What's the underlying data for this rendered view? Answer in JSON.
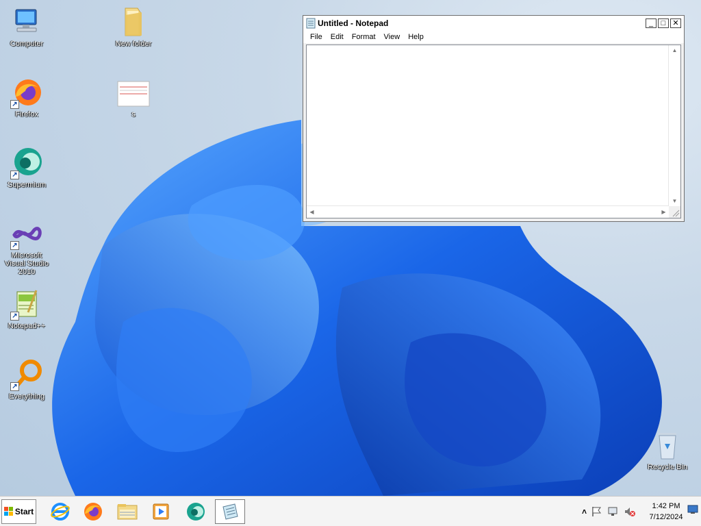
{
  "desktop": {
    "icons": [
      {
        "label": "Computer",
        "icon": "computer-icon"
      },
      {
        "label": "New folder",
        "icon": "folder-icon"
      },
      {
        "label": "Firefox",
        "icon": "firefox-icon"
      },
      {
        "label": "s",
        "icon": "document-icon"
      },
      {
        "label": "Supermium",
        "icon": "supermium-icon"
      },
      {
        "label": "Microsoft Visual Studio 2010",
        "icon": "visual-studio-icon"
      },
      {
        "label": "Notepad++",
        "icon": "notepad-plus-plus-icon"
      },
      {
        "label": "Everything",
        "icon": "everything-search-icon"
      },
      {
        "label": "Recycle Bin",
        "icon": "recycle-bin-icon"
      }
    ]
  },
  "notepad": {
    "title": "Untitled - Notepad",
    "minimize": "_",
    "maximize": "□",
    "close": "✕",
    "menu": [
      "File",
      "Edit",
      "Format",
      "View",
      "Help"
    ],
    "content": ""
  },
  "taskbar": {
    "start_label": "Start",
    "pinned": [
      "internet-explorer-icon",
      "firefox-icon",
      "file-explorer-icon",
      "media-player-icon",
      "supermium-icon",
      "notepad-icon"
    ],
    "tray_chevron": "˄",
    "time": "1:42 PM",
    "date": "7/12/2024"
  },
  "colors": {
    "accent_blue": "#1a66e8",
    "firefox_orange": "#ff7a1a",
    "everything_orange": "#f08a00"
  }
}
